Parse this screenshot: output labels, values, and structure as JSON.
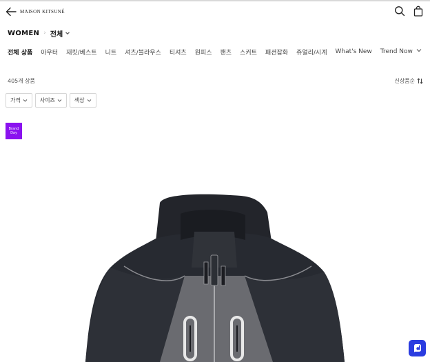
{
  "header": {
    "logo_text": "MAISON KITSUNÉ",
    "back_icon": "arrow-left-icon",
    "search_icon": "search-icon",
    "bag_icon": "shopping-bag-icon"
  },
  "breadcrumb": {
    "section": "WOMEN",
    "separator": "›",
    "current": "전체"
  },
  "categories": [
    {
      "label": "전체 상품",
      "active": true
    },
    {
      "label": "아우터",
      "active": false
    },
    {
      "label": "재킷/베스트",
      "active": false
    },
    {
      "label": "니트",
      "active": false
    },
    {
      "label": "셔츠/블라우스",
      "active": false
    },
    {
      "label": "티셔츠",
      "active": false
    },
    {
      "label": "원피스",
      "active": false
    },
    {
      "label": "팬츠",
      "active": false
    },
    {
      "label": "스커트",
      "active": false
    },
    {
      "label": "패션잡화",
      "active": false
    },
    {
      "label": "쥬얼리/시계",
      "active": false
    },
    {
      "label": "What's New",
      "active": false
    },
    {
      "label": "Trend Now",
      "active": false
    }
  ],
  "listing": {
    "count_text": "405개 상품",
    "sort_label": "신상품순"
  },
  "filters": [
    {
      "label": "가격"
    },
    {
      "label": "사이즈"
    },
    {
      "label": "색상"
    }
  ],
  "badge": {
    "line1": "Brand",
    "line2": "Day",
    "color": "#8a12ef"
  },
  "chat": {
    "icon": "chat-d-icon",
    "color": "#2a3ce0"
  }
}
